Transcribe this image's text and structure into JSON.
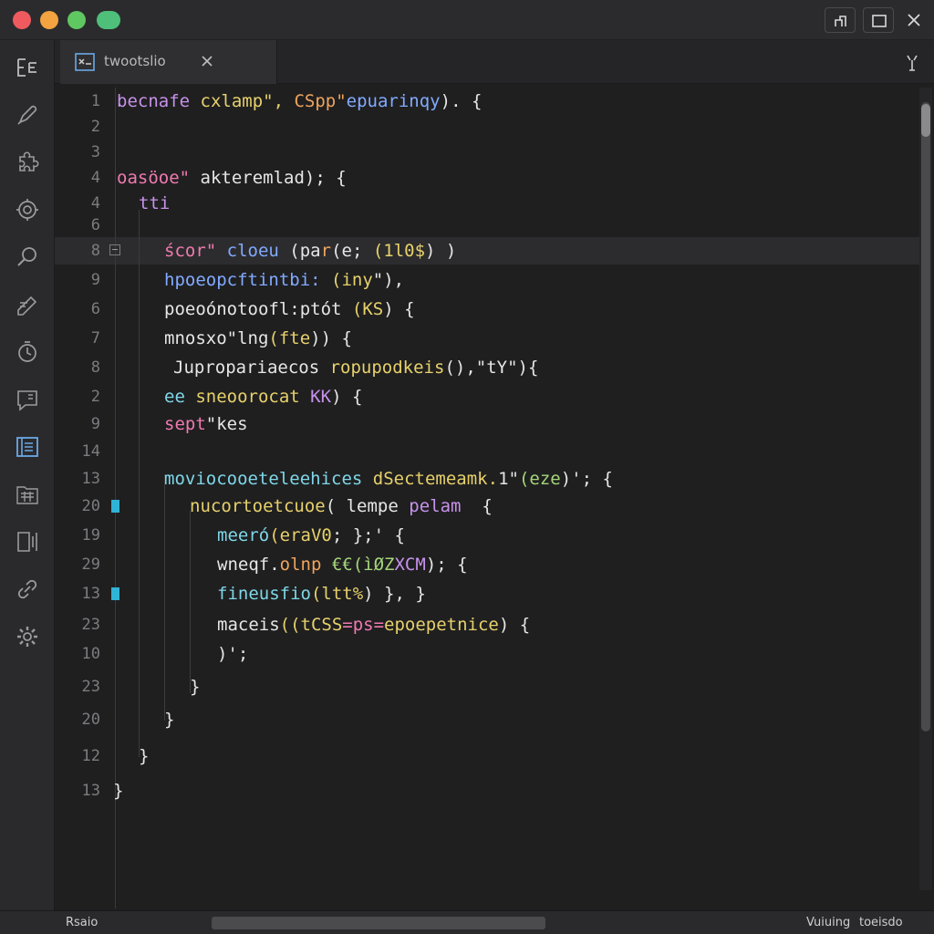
{
  "window": {
    "controls": [
      "close",
      "minimize",
      "zoom"
    ],
    "buttons": [
      "restore-icon",
      "maximize-icon",
      "close-icon"
    ]
  },
  "activity_bar": {
    "icons": [
      "explorer-icon",
      "pen-icon",
      "puzzle-icon",
      "settings-ring-icon",
      "search-icon",
      "edit-note-icon",
      "timer-icon",
      "comment-icon",
      "file-panel-icon",
      "folder-grid-icon",
      "columns-icon",
      "link-icon",
      "gear-icon"
    ]
  },
  "tab": {
    "label": "twootslio"
  },
  "editor": {
    "lines": [
      {
        "num": "1",
        "segments": [
          {
            "t": "becnafe ",
            "c": "purple"
          },
          {
            "t": "cxlamp\", ",
            "c": "yellow"
          },
          {
            "t": "CSpp\"",
            "c": "orange"
          },
          {
            "t": "epuarinqy",
            "c": "blue"
          },
          {
            "t": "). {",
            "c": "white"
          }
        ]
      },
      {
        "num": "2",
        "segments": []
      },
      {
        "num": "3",
        "segments": []
      },
      {
        "num": "4",
        "segments": [
          {
            "t": "oasöoe\" ",
            "c": "pink"
          },
          {
            "t": "akteremlad",
            "c": "white"
          },
          {
            "t": "); {",
            "c": "white"
          }
        ]
      },
      {
        "num": "4",
        "segments": [
          {
            "t": "tti",
            "c": "purple"
          }
        ]
      },
      {
        "num": "6",
        "segments": []
      },
      {
        "num": "8",
        "segments": [
          {
            "t": "ścor\" ",
            "c": "pink"
          },
          {
            "t": "cloeu ",
            "c": "blue"
          },
          {
            "t": "(pa",
            "c": "white"
          },
          {
            "t": "r",
            "c": "orange"
          },
          {
            "t": "(e; ",
            "c": "white"
          },
          {
            "t": "(1l0$",
            "c": "yellow"
          },
          {
            "t": ") )",
            "c": "white"
          }
        ]
      },
      {
        "num": "9",
        "segments": [
          {
            "t": "hpoeopcftintbi: ",
            "c": "blue"
          },
          {
            "t": "(iny",
            "c": "yellow"
          },
          {
            "t": "\"),",
            "c": "white"
          }
        ]
      },
      {
        "num": "6",
        "segments": [
          {
            "t": "poeoónotoofl:ptót ",
            "c": "white"
          },
          {
            "t": "(KS",
            "c": "yellow"
          },
          {
            "t": ") {",
            "c": "white"
          }
        ]
      },
      {
        "num": "7",
        "segments": [
          {
            "t": "mnosxo\"",
            "c": "white"
          },
          {
            "t": "lng",
            "c": "white"
          },
          {
            "t": "(fte",
            "c": "yellow"
          },
          {
            "t": ")) {",
            "c": "white"
          }
        ]
      },
      {
        "num": "8",
        "segments": [
          {
            "t": "Jupropariaecos ",
            "c": "white"
          },
          {
            "t": "ropupodkeis",
            "c": "yellow"
          },
          {
            "t": "(),\"tY\"){",
            "c": "white"
          }
        ]
      },
      {
        "num": "2",
        "segments": [
          {
            "t": "ee ",
            "c": "cyan"
          },
          {
            "t": "sneoorocat ",
            "c": "yellow"
          },
          {
            "t": "KK",
            "c": "purple"
          },
          {
            "t": ") {",
            "c": "white"
          }
        ]
      },
      {
        "num": "9",
        "segments": [
          {
            "t": "sept",
            "c": "pink"
          },
          {
            "t": "\"kes",
            "c": "white"
          }
        ]
      },
      {
        "num": "14",
        "segments": []
      },
      {
        "num": "13",
        "segments": [
          {
            "t": "moviocooeteleehices ",
            "c": "cyan"
          },
          {
            "t": "dSectemeamk.",
            "c": "yellow"
          },
          {
            "t": "1\"",
            "c": "white"
          },
          {
            "t": "(eze",
            "c": "green"
          },
          {
            "t": ")'; {",
            "c": "white"
          }
        ]
      },
      {
        "num": "20",
        "segments": [
          {
            "t": "nucortoetcuoe",
            "c": "yellow"
          },
          {
            "t": "( ",
            "c": "white"
          },
          {
            "t": "lempe ",
            "c": "white"
          },
          {
            "t": "pelam",
            "c": "purple"
          },
          {
            "t": "  {",
            "c": "white"
          }
        ]
      },
      {
        "num": "19",
        "segments": [
          {
            "t": "meeró",
            "c": "cyan"
          },
          {
            "t": "(eraV0",
            "c": "yellow"
          },
          {
            "t": "; };' {",
            "c": "white"
          }
        ]
      },
      {
        "num": "29",
        "segments": [
          {
            "t": "wneqf.",
            "c": "white"
          },
          {
            "t": "olnp ",
            "c": "orange"
          },
          {
            "t": "€€(ìØZ",
            "c": "green"
          },
          {
            "t": "XCM",
            "c": "purple"
          },
          {
            "t": "); {",
            "c": "white"
          }
        ]
      },
      {
        "num": "13",
        "segments": [
          {
            "t": "fineusfio",
            "c": "cyan"
          },
          {
            "t": "(ltt%",
            "c": "yellow"
          },
          {
            "t": ") }, }",
            "c": "white"
          }
        ]
      },
      {
        "num": "23",
        "segments": [
          {
            "t": "maceis",
            "c": "white"
          },
          {
            "t": "((tCSS",
            "c": "yellow"
          },
          {
            "t": "=ps=",
            "c": "pink"
          },
          {
            "t": "epoepetnice",
            "c": "yellow"
          },
          {
            "t": ") {",
            "c": "white"
          }
        ]
      },
      {
        "num": "10",
        "segments": [
          {
            "t": ")';",
            "c": "white"
          }
        ]
      },
      {
        "num": "23",
        "segments": [
          {
            "t": "}",
            "c": "white"
          }
        ]
      },
      {
        "num": "20",
        "segments": [
          {
            "t": "}",
            "c": "white"
          }
        ]
      },
      {
        "num": "12",
        "segments": [
          {
            "t": "}",
            "c": "white"
          }
        ]
      },
      {
        "num": "13",
        "segments": [
          {
            "t": "}",
            "c": "white"
          }
        ]
      }
    ]
  },
  "status_bar": {
    "left": "Rsaio",
    "right_1": "Vuiuing",
    "right_2": "toeisdo"
  },
  "colors": {
    "purple": "#c792ea",
    "yellow": "#e7d16b",
    "orange": "#f0a45d",
    "blue": "#82aaff",
    "green": "#a5d67a",
    "white": "#e6e6e6",
    "pink": "#f07ab0",
    "cyan": "#7fd7e8",
    "marker": "#2fb3d6"
  }
}
